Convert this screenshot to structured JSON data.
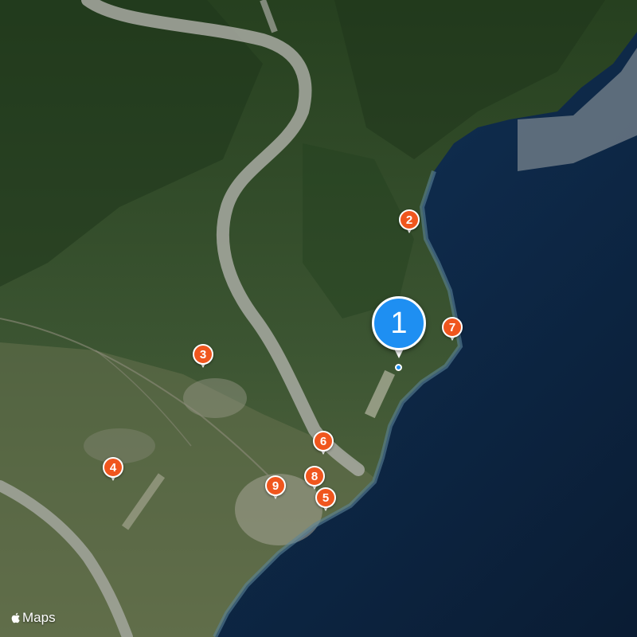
{
  "map": {
    "type": "satellite",
    "colors": {
      "sea_deep": "#0e2a4a",
      "sea_shallow": "#2b4f66",
      "land_forest": "#2d4a28",
      "land_plain": "#5f6a45",
      "river": "#a9aba3",
      "urban": "#9c9a8c",
      "pin_orange": "#f0561e",
      "pin_blue": "#1e8ff2"
    }
  },
  "pins": {
    "primary": {
      "label": "1"
    },
    "p2": {
      "label": "2"
    },
    "p3": {
      "label": "3"
    },
    "p4": {
      "label": "4"
    },
    "p5": {
      "label": "5"
    },
    "p6": {
      "label": "6"
    },
    "p7": {
      "label": "7"
    },
    "p8": {
      "label": "8"
    },
    "p9": {
      "label": "9"
    }
  },
  "attribution": {
    "text": "Maps",
    "logo_icon": "apple-logo-icon"
  }
}
